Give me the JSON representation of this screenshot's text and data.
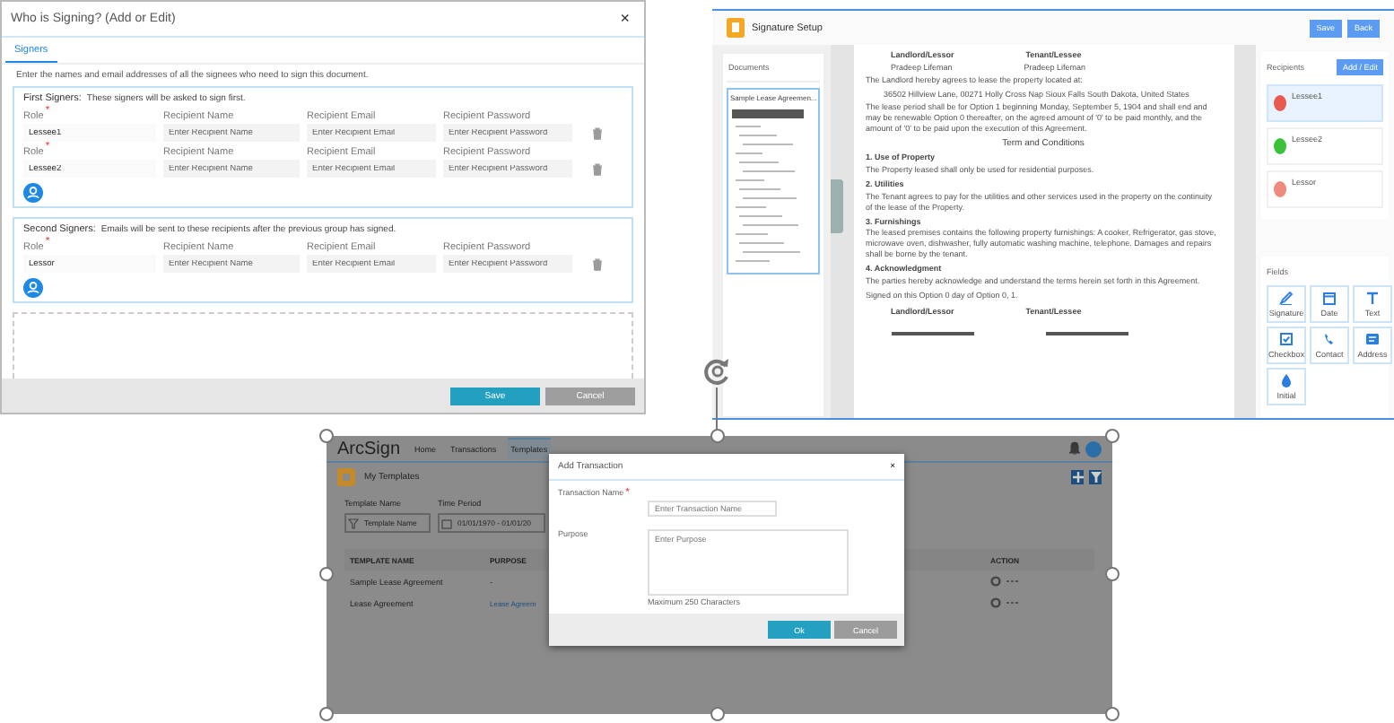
{
  "signers_dialog": {
    "title": "Who is Signing? (Add or Edit)",
    "close": "×",
    "tabs": [
      {
        "label": "Signers",
        "selected": true
      }
    ],
    "instructions": "Enter the names and email addresses of all the signees who need to sign this document.",
    "groups": [
      {
        "heading": "First Signers:",
        "note": "These signers will be asked to sign first.",
        "rows": [
          {
            "role_label": "Role",
            "required": "*",
            "role": "Lessee1",
            "columns": [
              "Recipient Name",
              "Recipient Email",
              "Recipient Password"
            ],
            "placeholders": [
              "Enter Recipient Name",
              "Enter Recipient Email",
              "Enter Recipient Password"
            ]
          },
          {
            "role_label": "Role",
            "required": "*",
            "role": "Lessee2",
            "columns": [
              "Recipient Name",
              "Recipient Email",
              "Recipient Password"
            ],
            "placeholders": [
              "Enter Recipient Name",
              "Enter Recipient Email",
              "Enter Recipient Password"
            ]
          }
        ]
      },
      {
        "heading": "Second Signers:",
        "note": "Emails will be sent to these recipients after the previous group has signed.",
        "rows": [
          {
            "role_label": "Role",
            "required": "*",
            "role": "Lessor",
            "columns": [
              "Recipient Name",
              "Recipient Email",
              "Recipient Password"
            ],
            "placeholders": [
              "Enter Recipient Name",
              "Enter Recipient Email",
              "Enter Recipient Password"
            ]
          }
        ]
      }
    ],
    "buttons": [
      {
        "label": "Save",
        "kind": "primary"
      },
      {
        "label": "Cancel",
        "kind": "secondary"
      }
    ]
  },
  "signature_setup": {
    "title": "Signature Setup",
    "buttons": [
      "Save",
      "Back"
    ],
    "documents": {
      "heading": "Documents",
      "items": [
        {
          "label": "Sample Lease Agreemen...",
          "selected": true
        }
      ]
    },
    "page": [
      {
        "kind": "parties",
        "texts": [
          "Landlord/Lessor",
          "Tenant/Lessee"
        ]
      },
      {
        "kind": "parties_sub",
        "texts": [
          "Pradeep Lifeman",
          "Pradeep Lifeman"
        ]
      },
      {
        "kind": "para",
        "text": "The Landlord hereby agrees to lease the property located at:"
      },
      {
        "kind": "indent",
        "text": "36502 Hillview Lane, 00271 Holly Cross Nap Sioux Falls South Dakota, United States"
      },
      {
        "kind": "para",
        "text": "The lease period shall be for Option 1 beginning Monday, September 5, 1904 and shall end and may be renewable Option 0 thereafter, on the agreed amount of '0' to be paid monthly, and the amount of '0' to be paid upon the execution of this Agreement."
      },
      {
        "kind": "center",
        "text": "Term and Conditions"
      },
      {
        "kind": "heading",
        "text": "1. Use of Property"
      },
      {
        "kind": "para",
        "text": "The Property leased shall only be used for residential purposes."
      },
      {
        "kind": "heading",
        "text": "2. Utilities"
      },
      {
        "kind": "para",
        "text": "The Tenant agrees to pay for the utilities and other services used in the property on the continuity of the lease of the Property."
      },
      {
        "kind": "heading",
        "text": "3. Furnishings"
      },
      {
        "kind": "para",
        "text": "The leased premises contains the following property furnishings: A cooker, Refrigerator, gas stove, microwave oven, dishwasher, fully automatic washing machine, telephone. Damages and repairs shall be borne by the tenant."
      },
      {
        "kind": "heading",
        "text": "4. Acknowledgment"
      },
      {
        "kind": "para",
        "text": "The parties hereby acknowledge and understand the terms herein set forth in this Agreement."
      },
      {
        "kind": "para",
        "text": "Signed on this Option 0 day of Option 0, 1."
      },
      {
        "kind": "parties",
        "texts": [
          "Landlord/Lessor",
          "Tenant/Lessee"
        ]
      }
    ],
    "recipients": {
      "heading": "Recipients",
      "button": "Add / Edit",
      "items": [
        {
          "name": "Lessee1",
          "color": "#e8594f",
          "selected": true
        },
        {
          "name": "Lessee2",
          "color": "#3cc13b",
          "selected": false
        },
        {
          "name": "Lessor",
          "color": "#f08a7e",
          "selected": false
        }
      ]
    },
    "fields": {
      "heading": "Fields",
      "items": [
        {
          "label": "Signature",
          "kind": "signature"
        },
        {
          "label": "Date",
          "kind": "date"
        },
        {
          "label": "Text",
          "kind": "text"
        },
        {
          "label": "Checkbox",
          "kind": "checkbox"
        },
        {
          "label": "Contact",
          "kind": "contact"
        },
        {
          "label": "Address",
          "kind": "address"
        },
        {
          "label": "Initial",
          "kind": "initial"
        }
      ]
    }
  },
  "templates_app": {
    "logo": "ArcSign",
    "nav": [
      {
        "label": "Home",
        "selected": false
      },
      {
        "label": "Transactions",
        "selected": false
      },
      {
        "label": "Templates",
        "selected": true
      }
    ],
    "page_title": "My Templates",
    "filters": [
      {
        "label": "Template Name",
        "placeholder": "Template Name",
        "kind": "filter"
      },
      {
        "label": "Time Period",
        "value": "01/01/1970 - 01/01/20",
        "kind": "date"
      }
    ],
    "table": {
      "columns": [
        "TEMPLATE NAME",
        "PURPOSE",
        "ACTION"
      ],
      "rows": [
        {
          "name": "Sample Lease Agreement",
          "purpose": "-",
          "link": false
        },
        {
          "name": "Lease Agreement",
          "purpose": "Lease Agreem",
          "link": true
        }
      ]
    },
    "modal": {
      "title": "Add Transaction",
      "close": "×",
      "fields": [
        {
          "label": "Transaction Name",
          "required": "*",
          "placeholder": "Enter Transaction Name",
          "kind": "text"
        },
        {
          "label": "Purpose",
          "placeholder": "Enter Purpose",
          "hint": "Maximum 250 Characters",
          "kind": "textarea"
        }
      ],
      "buttons": [
        {
          "label": "Ok",
          "kind": "primary"
        },
        {
          "label": "Cancel",
          "kind": "secondary"
        }
      ]
    }
  }
}
